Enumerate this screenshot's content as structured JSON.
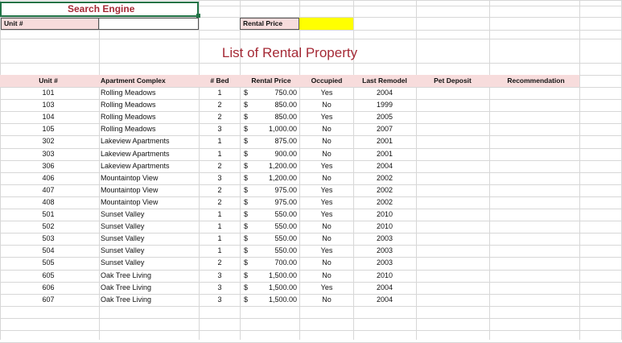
{
  "search": {
    "title": "Search Engine",
    "unit_label": "Unit #",
    "unit_value": "",
    "price_label": "Rental Price",
    "price_value": ""
  },
  "table": {
    "title": "List of Rental Property",
    "headers": [
      "Unit #",
      "Apartment Complex",
      "# Bed",
      "Rental Price",
      "Occupied",
      "Last Remodel",
      "Pet Deposit",
      "Recommendation"
    ],
    "currency_symbol": "$",
    "rows": [
      [
        "101",
        "Rolling Meadows",
        "1",
        "750.00",
        "Yes",
        "2004"
      ],
      [
        "103",
        "Rolling Meadows",
        "2",
        "850.00",
        "No",
        "1999"
      ],
      [
        "104",
        "Rolling Meadows",
        "2",
        "850.00",
        "Yes",
        "2005"
      ],
      [
        "105",
        "Rolling Meadows",
        "3",
        "1,000.00",
        "No",
        "2007"
      ],
      [
        "302",
        "Lakeview Apartments",
        "1",
        "875.00",
        "No",
        "2001"
      ],
      [
        "303",
        "Lakeview Apartments",
        "1",
        "900.00",
        "No",
        "2001"
      ],
      [
        "306",
        "Lakeview Apartments",
        "2",
        "1,200.00",
        "Yes",
        "2004"
      ],
      [
        "406",
        "Mountaintop View",
        "3",
        "1,200.00",
        "No",
        "2002"
      ],
      [
        "407",
        "Mountaintop View",
        "2",
        "975.00",
        "Yes",
        "2002"
      ],
      [
        "408",
        "Mountaintop View",
        "2",
        "975.00",
        "Yes",
        "2002"
      ],
      [
        "501",
        "Sunset Valley",
        "1",
        "550.00",
        "Yes",
        "2010"
      ],
      [
        "502",
        "Sunset Valley",
        "1",
        "550.00",
        "No",
        "2010"
      ],
      [
        "503",
        "Sunset Valley",
        "1",
        "550.00",
        "No",
        "2003"
      ],
      [
        "504",
        "Sunset Valley",
        "1",
        "550.00",
        "Yes",
        "2003"
      ],
      [
        "505",
        "Sunset Valley",
        "2",
        "700.00",
        "No",
        "2003"
      ],
      [
        "605",
        "Oak Tree Living",
        "3",
        "1,500.00",
        "No",
        "2010"
      ],
      [
        "606",
        "Oak Tree Living",
        "3",
        "1,500.00",
        "Yes",
        "2004"
      ],
      [
        "607",
        "Oak Tree Living",
        "3",
        "1,500.00",
        "No",
        "2004"
      ]
    ]
  },
  "colors": {
    "accent_text": "#a52a36",
    "selection_border": "#217346",
    "header_fill": "#f7dcdc",
    "highlight_fill": "#ffff00",
    "gridline": "#d7d7d7"
  }
}
